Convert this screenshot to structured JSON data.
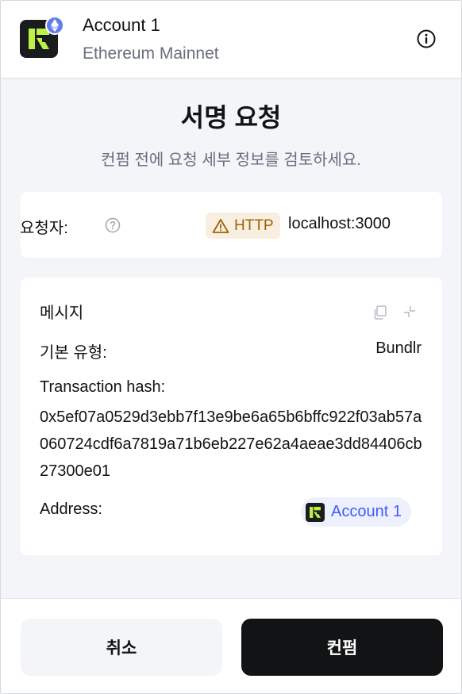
{
  "header": {
    "account_name": "Account 1",
    "network_name": "Ethereum Mainnet",
    "info_icon": "info-icon",
    "network_icon": "ethereum-icon"
  },
  "title": "서명 요청",
  "subtitle": "컨펌 전에 요청 세부 정보를 검토하세요.",
  "request": {
    "label": "요청자:",
    "protocol_badge": "HTTP",
    "origin": "localhost:3000"
  },
  "message": {
    "title": "메시지",
    "primary_type_label": "기본 유형:",
    "primary_type_value": "Bundlr",
    "hash_label": "Transaction hash:",
    "hash_value": "0x5ef07a0529d3ebb7f13e9be6a65b6bffc922f03ab57a060724cdf6a7819a71b6eb227e62a4aeae3dd84406cb27300e01",
    "address_label": "Address:",
    "address_account": "Account 1"
  },
  "footer": {
    "cancel_label": "취소",
    "confirm_label": "컨펌"
  },
  "colors": {
    "accent": "#4459ff",
    "warning": "#a06200",
    "warning_bg": "#f8efe0",
    "primary_button": "#121314",
    "ethereum": "#627eea"
  }
}
